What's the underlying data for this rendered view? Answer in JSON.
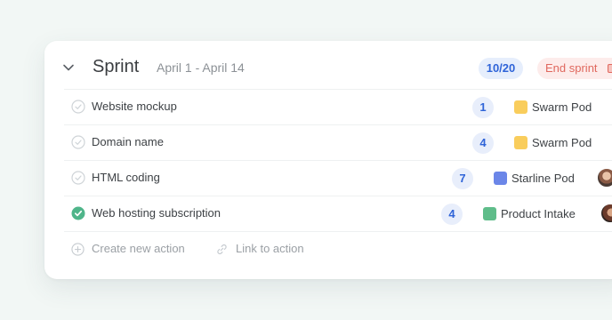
{
  "sprint": {
    "title": "Sprint",
    "dates": "April 1 - April 14",
    "progress": "10/20",
    "end_label": "End sprint"
  },
  "rows": [
    {
      "task": "Website mockup",
      "count": "1",
      "pod": "Swarm Pod",
      "pod_color": "#f9cd5c",
      "done": false,
      "avatar": false
    },
    {
      "task": "Domain name",
      "count": "4",
      "pod": "Swarm Pod",
      "pod_color": "#f9cd5c",
      "done": false,
      "avatar": false
    },
    {
      "task": "HTML coding",
      "count": "7",
      "pod": "Starline Pod",
      "pod_color": "#6b86e8",
      "done": false,
      "avatar": true
    },
    {
      "task": "Web hosting subscription",
      "count": "4",
      "pod": "Product Intake",
      "pod_color": "#5fbd8a",
      "done": true,
      "avatar": true
    }
  ],
  "footer": {
    "create": "Create new action",
    "link": "Link to action"
  },
  "colors": {
    "accent_blue": "#2f64d8",
    "done_green": "#4fb58a",
    "end_red": "#e0685e"
  }
}
